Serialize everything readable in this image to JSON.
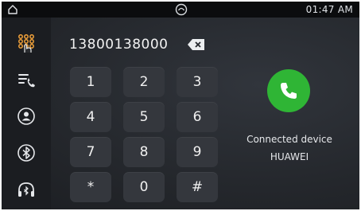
{
  "status_bar": {
    "time": "01:47 AM",
    "home_icon": "home-icon",
    "brand_icon": "brand-logo-icon"
  },
  "sidebar": {
    "items": [
      {
        "name": "dialpad",
        "icon": "dialpad-grid-icon",
        "active": true
      },
      {
        "name": "call-log",
        "icon": "call-log-icon",
        "active": false
      },
      {
        "name": "contacts",
        "icon": "contacts-icon",
        "active": false
      },
      {
        "name": "bluetooth",
        "icon": "bluetooth-icon",
        "active": false
      },
      {
        "name": "bluetooth-audio",
        "icon": "bluetooth-headset-icon",
        "active": false
      }
    ]
  },
  "dialer": {
    "number": "13800138000",
    "backspace_icon": "backspace-icon",
    "keys": [
      "1",
      "2",
      "3",
      "4",
      "5",
      "6",
      "7",
      "8",
      "9",
      "*",
      "0",
      "#"
    ]
  },
  "call": {
    "button_icon": "phone-call-icon",
    "connected_label": "Connected device",
    "device_name": "HUAWEI"
  },
  "colors": {
    "accent_orange": "#f2a23a",
    "call_green": "#2fb535",
    "key_bg": "#34373d",
    "background": "#25282d"
  }
}
